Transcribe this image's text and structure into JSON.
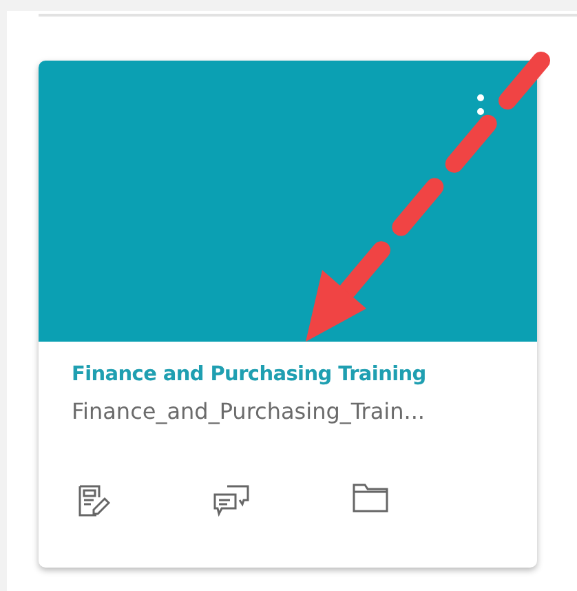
{
  "card": {
    "title": "Finance and Purchasing Training",
    "subtitle": "Finance_and_Purchasing_Train..."
  }
}
